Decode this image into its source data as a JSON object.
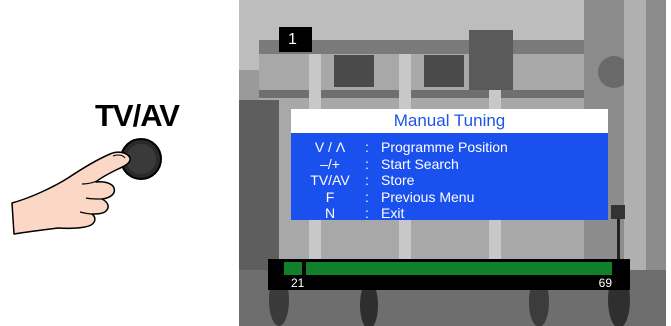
{
  "remote": {
    "button_label": "TV/AV",
    "pointer": "hand-pointing-icon"
  },
  "screen": {
    "channel_number": "1",
    "menu": {
      "title": "Manual Tuning",
      "items": [
        {
          "key": "V / Λ",
          "desc": "Programme Position"
        },
        {
          "key": "–/+",
          "desc": "Start Search"
        },
        {
          "key": "TV/AV",
          "desc": "Store"
        },
        {
          "key": "F",
          "desc": "Previous Menu"
        },
        {
          "key": "N",
          "desc": "Exit"
        }
      ]
    },
    "tuning": {
      "start": "21",
      "end": "69"
    },
    "colors": {
      "menu_bg": "#1a50ee",
      "menu_title_text": "#1d55e5",
      "bar_fill": "#11802a"
    }
  }
}
